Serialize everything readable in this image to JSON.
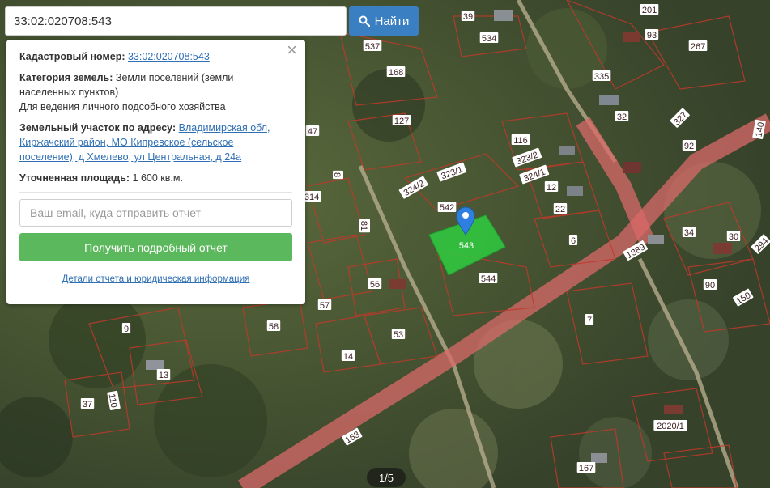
{
  "search": {
    "value": "33:02:020708:543",
    "button_label": "Найти"
  },
  "popup": {
    "cadastral_label": "Кадастровый номер:",
    "cadastral_value": "33:02:020708:543",
    "category_label": "Категория земель:",
    "category_value": "Земли поселений (земли населенных пунктов)",
    "usage": "Для ведения личного подсобного хозяйства",
    "address_label": "Земельный участок по адресу:",
    "address_value": "Владимирская обл, Киржачский район, МО Кипревское (сельское поселение), д Хмелево, ул Центральная, д 24а",
    "area_label": "Уточненная площадь:",
    "area_value": "1 600 кв.м.",
    "email_placeholder": "Ваш email, куда отправить отчет",
    "report_button": "Получить подробный отчет",
    "details_link": "Детали отчета и юридическая информация",
    "close_glyph": "×"
  },
  "pager": "1/5",
  "map": {
    "selected_label": "543",
    "parcel_labels": [
      "39",
      "201",
      "537",
      "534",
      "93",
      "267",
      "168",
      "335",
      "127",
      "32",
      "327",
      "140",
      "47",
      "116",
      "92",
      "323/2",
      "323/1",
      "324/1",
      "8",
      "324/2",
      "12",
      "314",
      "542",
      "22",
      "81",
      "6",
      "34",
      "30",
      "294",
      "1389",
      "544",
      "56",
      "90",
      "57",
      "150",
      "9",
      "58",
      "53",
      "7",
      "14",
      "13",
      "37",
      "110",
      "2020/1",
      "163",
      "167"
    ]
  },
  "colors": {
    "selected_parcel": "#2ecc40",
    "marker": "#2f7fe0",
    "road": "#d96a6a",
    "search_button": "#3a7fc1",
    "report_button": "#5cb85c"
  }
}
